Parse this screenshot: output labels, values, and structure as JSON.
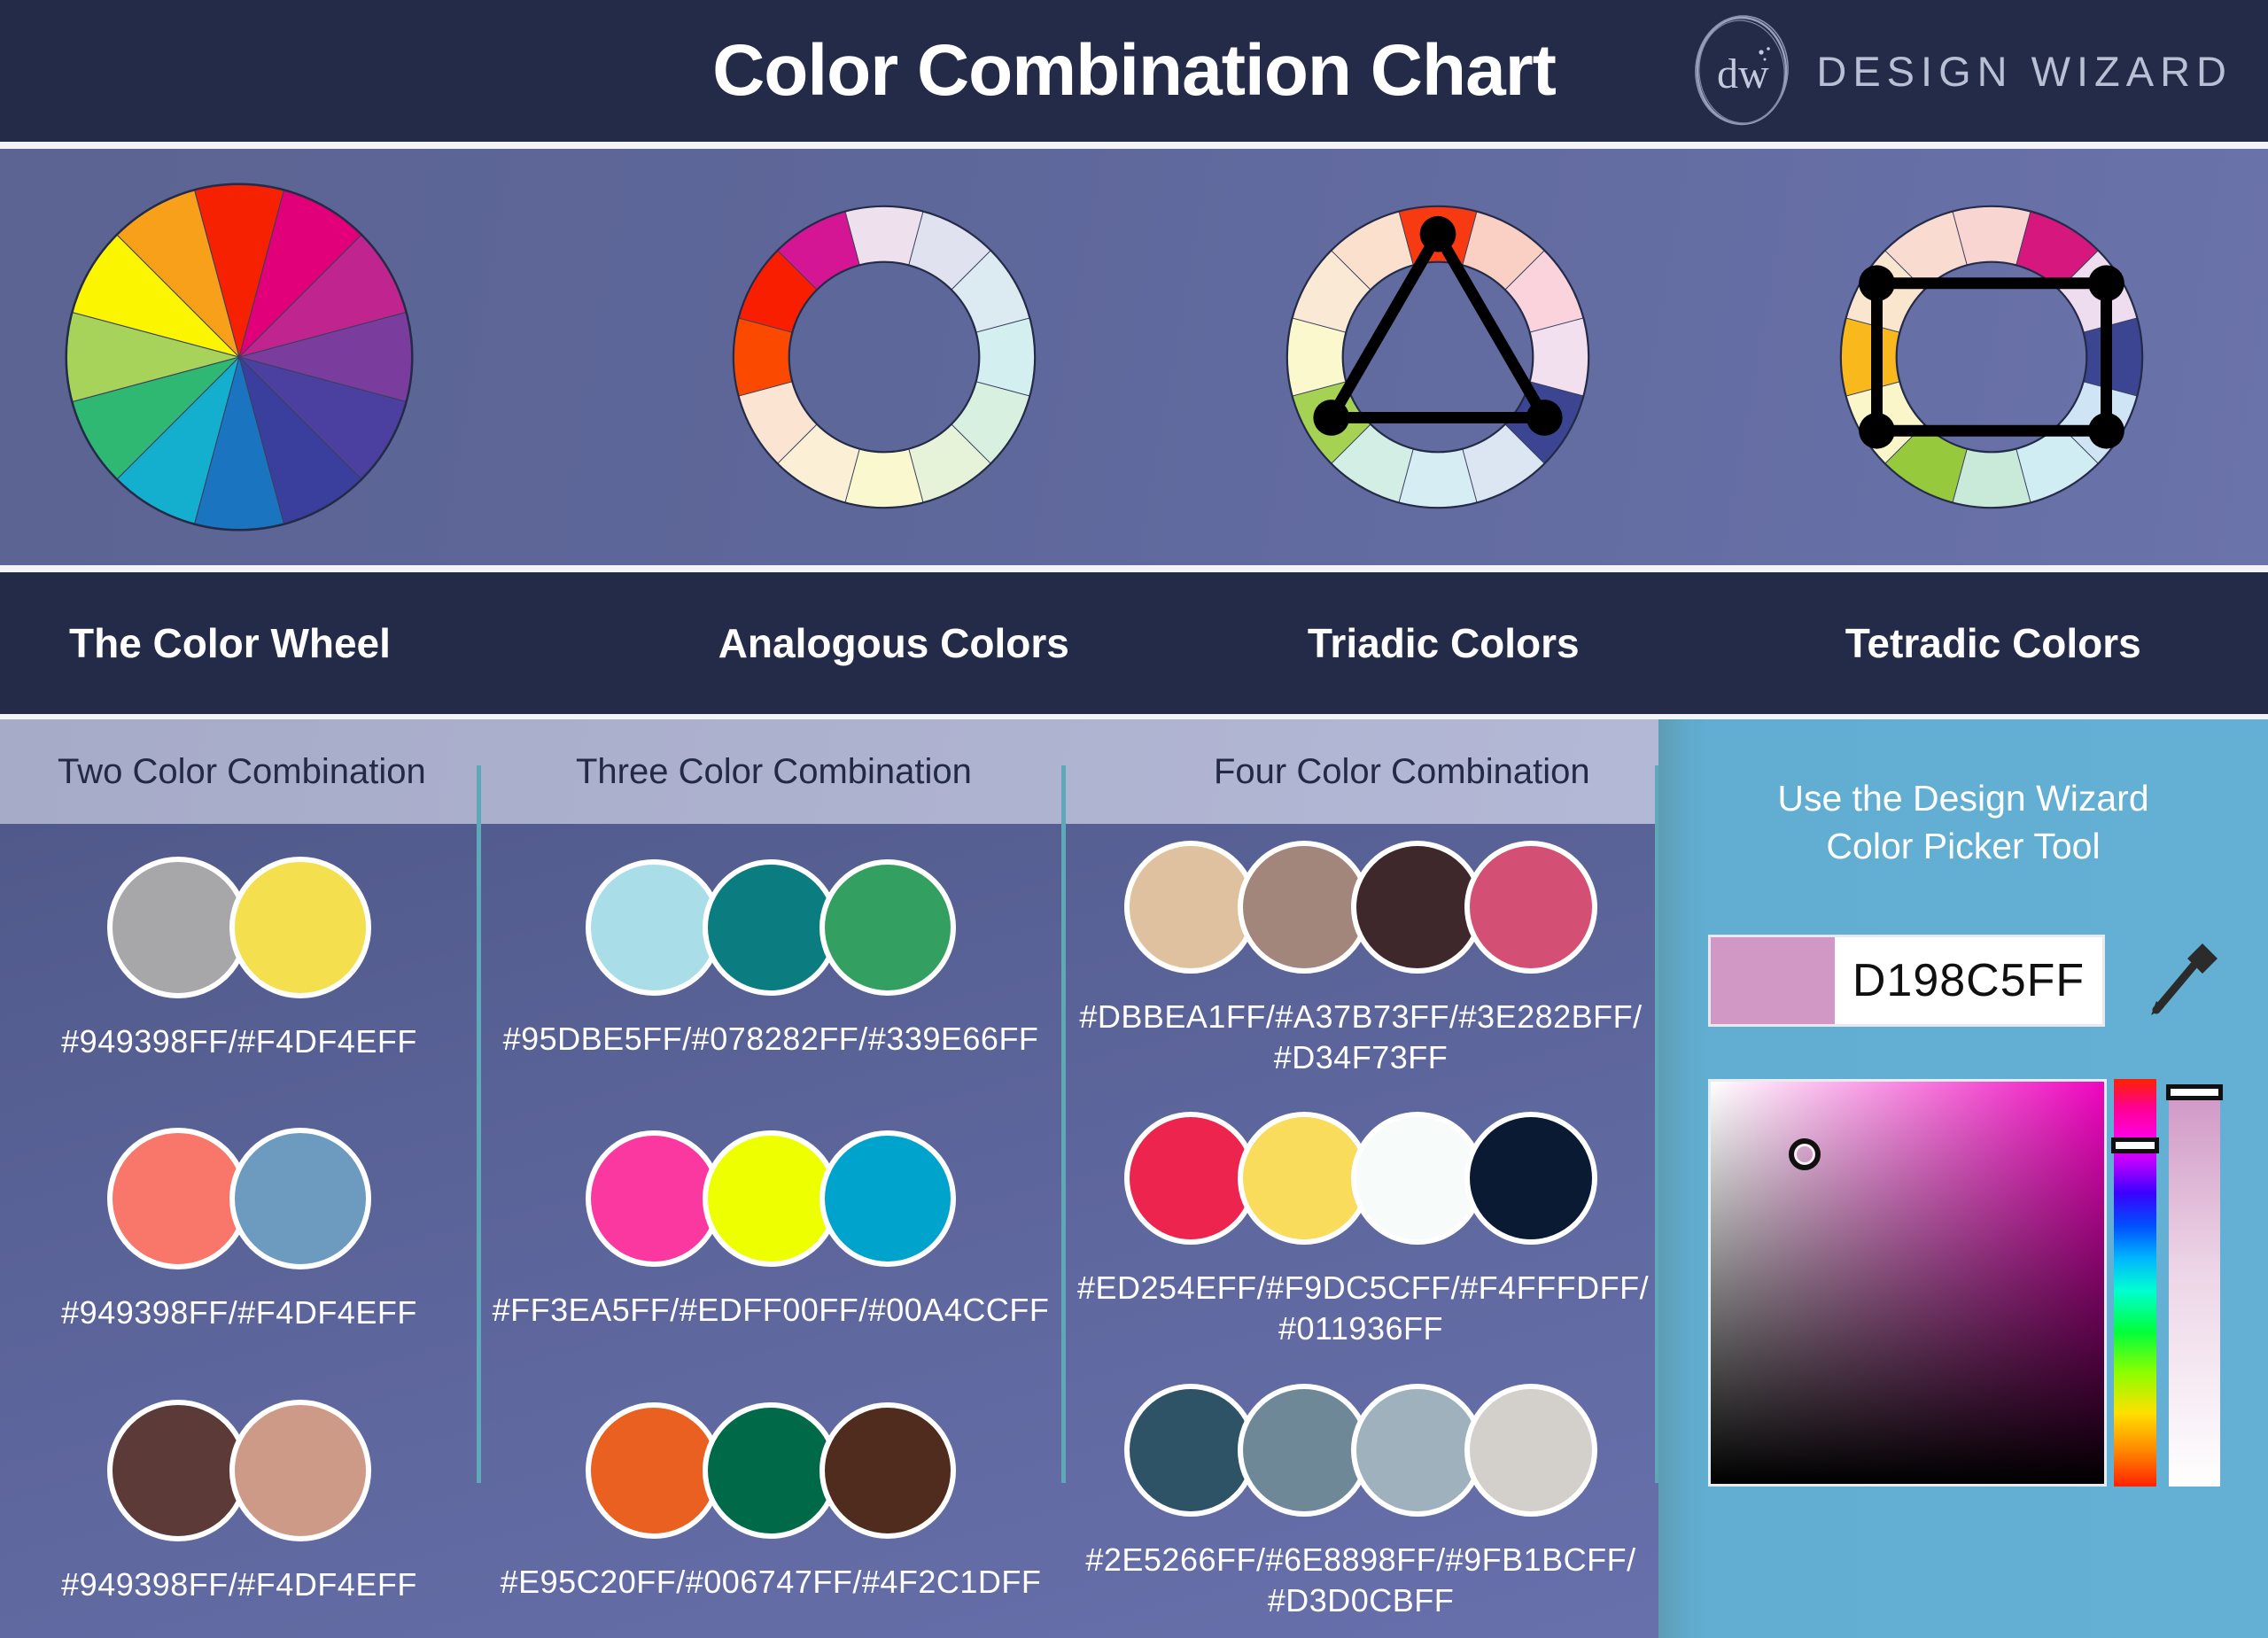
{
  "header": {
    "title": "Color Combination Chart",
    "logo_wordmark": "DESIGN WIZARD",
    "logo_monogram": "dw"
  },
  "scheme_labels": [
    "The Color Wheel",
    "Analogous Colors",
    "Triadic Colors",
    "Tetradic Colors"
  ],
  "wheels": {
    "color_wheel_segments": [
      "#F62100",
      "#E1007A",
      "#C0248E",
      "#7A3C9D",
      "#4B3FA0",
      "#3A3F9E",
      "#1B74C0",
      "#14AECF",
      "#2EB872",
      "#A7D35A",
      "#FCF500",
      "#F9A01B"
    ],
    "analogous_segments": [
      "#EFE0EE",
      "#E0E2F0",
      "#DCEAF2",
      "#D3EFF0",
      "#D8F0E0",
      "#E7F3D8",
      "#FAF8CF",
      "#FBF0D6",
      "#FBE4D2",
      "#FB4A00",
      "#F91E00",
      "#D41594"
    ],
    "triadic_segments": [
      "#F73A12",
      "#FBD0C4",
      "#FBD3DD",
      "#F3E0EE",
      "#3B4592",
      "#DCE6F3",
      "#D7EDF4",
      "#D3EEE4",
      "#A6D254",
      "#FAF8CC",
      "#FAE9D4",
      "#FBE0CE"
    ],
    "tetradic_segments": [
      "#F9D5D2",
      "#D5177E",
      "#EDDDEE",
      "#3B4592",
      "#CFE4F4",
      "#D0EDF3",
      "#C9EAD9",
      "#97C93D",
      "#FAF6CA",
      "#F9B81C",
      "#FAE6CE",
      "#FADBD0"
    ],
    "triadic_marker_count": 3,
    "tetradic_marker_count": 4
  },
  "combinations": {
    "column_headers": [
      "Two Color Combination",
      "Three Color Combination",
      "Four Color Combination"
    ],
    "two_color": [
      {
        "colors": [
          "#A7A7AA",
          "#F4DF4E"
        ],
        "hex_text": "#949398FF/#F4DF4EFF"
      },
      {
        "colors": [
          "#F8766A",
          "#6D9BBF"
        ],
        "hex_text": "#949398FF/#F4DF4EFF"
      },
      {
        "colors": [
          "#5C3A37",
          "#CD9A88"
        ],
        "hex_text": "#949398FF/#F4DF4EFF"
      }
    ],
    "three_color": [
      {
        "colors": [
          "#A9DEE8",
          "#0B7D80",
          "#33A062"
        ],
        "hex_text": "#95DBE5FF/#078282FF/#339E66FF"
      },
      {
        "colors": [
          "#FA38A0",
          "#EEFF00",
          "#00A3CC"
        ],
        "hex_text": "#FF3EA5FF/#EDFF00FF/#00A4CCFF"
      },
      {
        "colors": [
          "#EA6020",
          "#006A48",
          "#4F2C1D"
        ],
        "hex_text": "#E95C20FF/#006747FF/#4F2C1DFF"
      }
    ],
    "four_color": [
      {
        "colors": [
          "#DFC09F",
          "#A3867B",
          "#3E282B",
          "#D34F73"
        ],
        "hex_text": "#DBBEA1FF/#A37B73FF/#3E282BFF/ #D34F73FF"
      },
      {
        "colors": [
          "#ED254E",
          "#F9DC5C",
          "#F7FCFB",
          "#0B1A33"
        ],
        "hex_text": "#ED254EFF/#F9DC5CFF/#F4FFFDFF/ #011936FF"
      },
      {
        "colors": [
          "#2E5266",
          "#6E8898",
          "#9FB1BC",
          "#D3D0CB"
        ],
        "hex_text": "#2E5266FF/#6E8898FF/#9FB1BCFF/ #D3D0CBFF"
      }
    ]
  },
  "picker": {
    "title_line1": "Use the Design Wizard",
    "title_line2": "Color Picker Tool",
    "value": "D198C5FF",
    "swatch_color": "#D198C5",
    "eyedropper_icon": "eyedropper-icon"
  },
  "colors": {
    "header_bg": "#242b48",
    "wheel_strip_bg": "#5e679a",
    "combo_bg": "#5b6499",
    "combo_header_bg": "#aeb3d0",
    "picker_bg": "#63b0d4",
    "divider": "#5fa8b8",
    "text_light": "#ffffff",
    "text_dark": "#232a46"
  }
}
